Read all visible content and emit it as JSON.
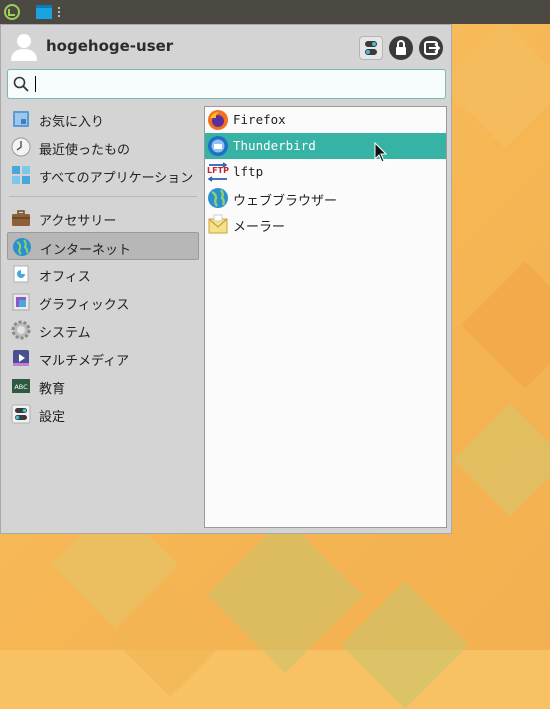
{
  "user": {
    "name": "hogehoge-user"
  },
  "search": {
    "value": "",
    "placeholder": ""
  },
  "categories": [
    {
      "label": "お気に入り",
      "icon": "favorites-icon"
    },
    {
      "label": "最近使ったもの",
      "icon": "recent-clock-icon"
    },
    {
      "label": "すべてのアプリケーション",
      "icon": "all-apps-icon"
    },
    {
      "label": "アクセサリー",
      "icon": "briefcase-icon"
    },
    {
      "label": "インターネット",
      "icon": "globe-icon",
      "selected": true
    },
    {
      "label": "オフィス",
      "icon": "office-icon"
    },
    {
      "label": "グラフィックス",
      "icon": "graphics-icon"
    },
    {
      "label": "システム",
      "icon": "gear-icon"
    },
    {
      "label": "マルチメディア",
      "icon": "multimedia-icon"
    },
    {
      "label": "教育",
      "icon": "abc-icon"
    },
    {
      "label": "設定",
      "icon": "settings-icon"
    }
  ],
  "apps": [
    {
      "label": "Firefox",
      "icon": "firefox-icon"
    },
    {
      "label": "Thunderbird",
      "icon": "thunderbird-icon",
      "selected": true
    },
    {
      "label": "lftp",
      "icon": "lftp-icon"
    },
    {
      "label": "ウェブブラウザー",
      "icon": "web-browser-icon"
    },
    {
      "label": "メーラー",
      "icon": "mail-icon"
    }
  ],
  "colors": {
    "accent": "#36b3a5",
    "menu_bg": "#d4d4d4",
    "panel_bg": "#4b4941"
  }
}
